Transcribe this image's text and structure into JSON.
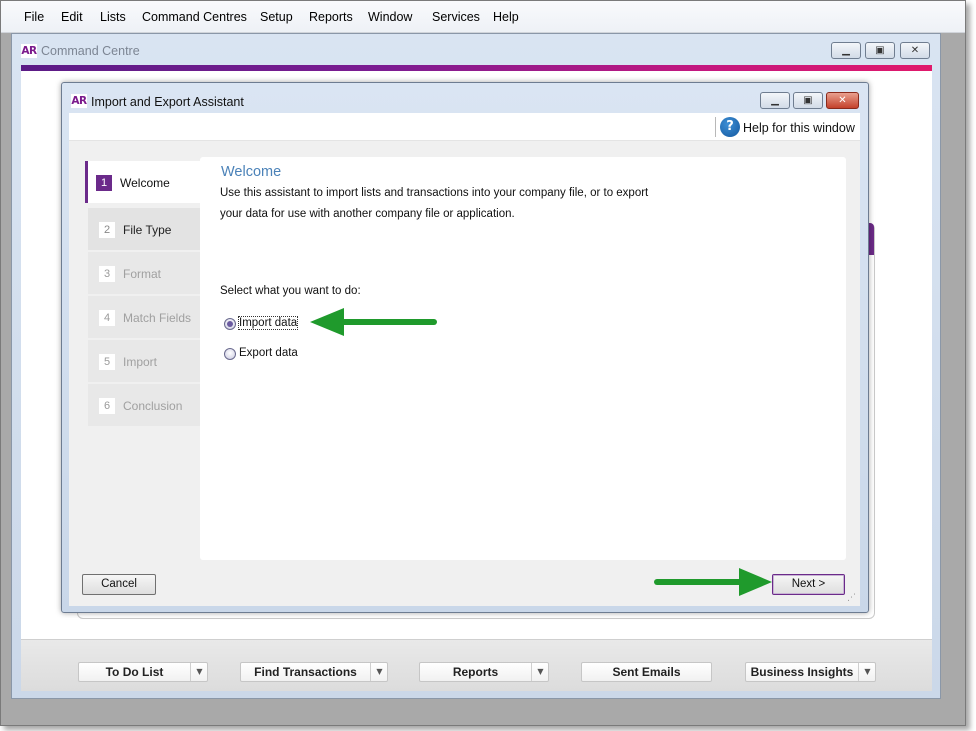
{
  "menubar": {
    "items": [
      "File",
      "Edit",
      "Lists",
      "Command Centres",
      "Setup",
      "Reports",
      "Window",
      "Services",
      "Help"
    ]
  },
  "command_centre": {
    "logo": "AR",
    "title": "Command Centre"
  },
  "dialog": {
    "logo": "AR",
    "title": "Import and Export Assistant",
    "help_label": "Help for this window",
    "steps": [
      {
        "num": "1",
        "label": "Welcome"
      },
      {
        "num": "2",
        "label": "File Type"
      },
      {
        "num": "3",
        "label": "Format"
      },
      {
        "num": "4",
        "label": "Match Fields"
      },
      {
        "num": "5",
        "label": "Import"
      },
      {
        "num": "6",
        "label": "Conclusion"
      }
    ],
    "active_step": 1,
    "main": {
      "title": "Welcome",
      "intro_line1": "Use this assistant to import lists and transactions into your company file, or to export",
      "intro_line2": "your data for use with another company file or application.",
      "prompt": "Select what you want to do:",
      "options": [
        {
          "label": "Import data",
          "checked": true
        },
        {
          "label": "Export data",
          "checked": false
        }
      ]
    },
    "cancel_label": "Cancel",
    "next_label": "Next >"
  },
  "bottom_toolbar": {
    "buttons": [
      {
        "label": "To Do List",
        "has_dropdown": true
      },
      {
        "label": "Find Transactions",
        "has_dropdown": true
      },
      {
        "label": "Reports",
        "has_dropdown": true
      },
      {
        "label": "Sent Emails",
        "has_dropdown": false
      },
      {
        "label": "Business Insights",
        "has_dropdown": true
      }
    ]
  },
  "colors": {
    "accent_purple": "#6b2a8a",
    "title_blue": "#4b82b8",
    "annotation_green": "#1f9a2c"
  },
  "icons": {
    "help": "help-circle-icon",
    "minimize": "minimize-icon",
    "maximize": "maximize-icon",
    "close": "close-icon",
    "dropdown": "chevron-down-icon"
  }
}
